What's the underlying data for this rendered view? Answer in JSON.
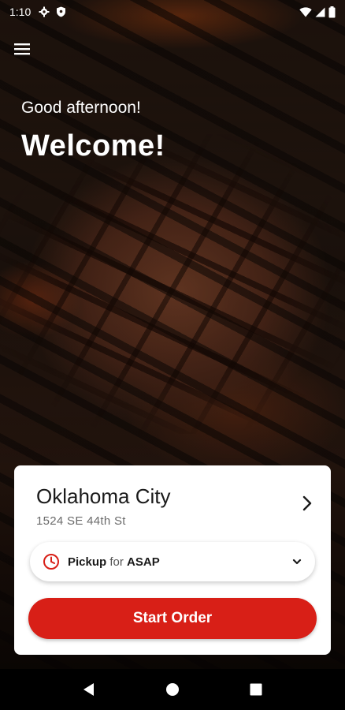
{
  "status_bar": {
    "time": "1:10",
    "left_icons": [
      "gear-icon",
      "shield-icon"
    ],
    "right_icons": [
      "wifi-icon",
      "signal-icon",
      "battery-icon"
    ]
  },
  "header": {
    "menu_icon": "hamburger-menu-icon"
  },
  "hero": {
    "greeting": "Good afternoon!",
    "welcome": "Welcome!"
  },
  "location": {
    "city": "Oklahoma City",
    "address": "1524 SE 44th St"
  },
  "pickup": {
    "mode": "Pickup",
    "connector": "for",
    "time": "ASAP",
    "icon": "clock-icon"
  },
  "start_order": {
    "label": "Start Order"
  },
  "colors": {
    "accent": "#d81f17",
    "card_background": "#ffffff"
  },
  "nav_bar": {
    "buttons": [
      "back-icon",
      "home-icon",
      "recents-icon"
    ]
  }
}
